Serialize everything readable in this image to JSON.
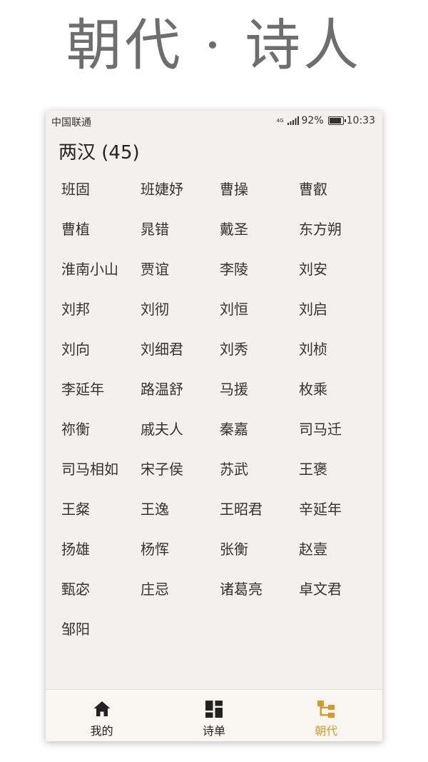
{
  "banner": {
    "title": "朝代 · 诗人"
  },
  "status_bar": {
    "carrier": "中国联通",
    "network": "4G",
    "battery": "92%",
    "time": "10:33"
  },
  "dynasty": {
    "title": "两汉 (45)"
  },
  "poets": [
    "班固",
    "班婕妤",
    "曹操",
    "曹叡",
    "曹植",
    "晁错",
    "戴圣",
    "东方朔",
    "淮南小山",
    "贾谊",
    "李陵",
    "刘安",
    "刘邦",
    "刘彻",
    "刘恒",
    "刘启",
    "刘向",
    "刘细君",
    "刘秀",
    "刘桢",
    "李延年",
    "路温舒",
    "马援",
    "枚乘",
    "祢衡",
    "戚夫人",
    "秦嘉",
    "司马迁",
    "司马相如",
    "宋子侯",
    "苏武",
    "王褒",
    "王粲",
    "王逸",
    "王昭君",
    "辛延年",
    "扬雄",
    "杨恽",
    "张衡",
    "赵壹",
    "甄宓",
    "庄忌",
    "诸葛亮",
    "卓文君",
    "邹阳"
  ],
  "nav": {
    "items": [
      {
        "label": "我的",
        "icon": "home-icon",
        "active": false
      },
      {
        "label": "诗单",
        "icon": "grid-icon",
        "active": false
      },
      {
        "label": "朝代",
        "icon": "dynasty-icon",
        "active": true
      }
    ],
    "colors": {
      "active": "#d49b2a",
      "inactive": "#222222"
    }
  }
}
